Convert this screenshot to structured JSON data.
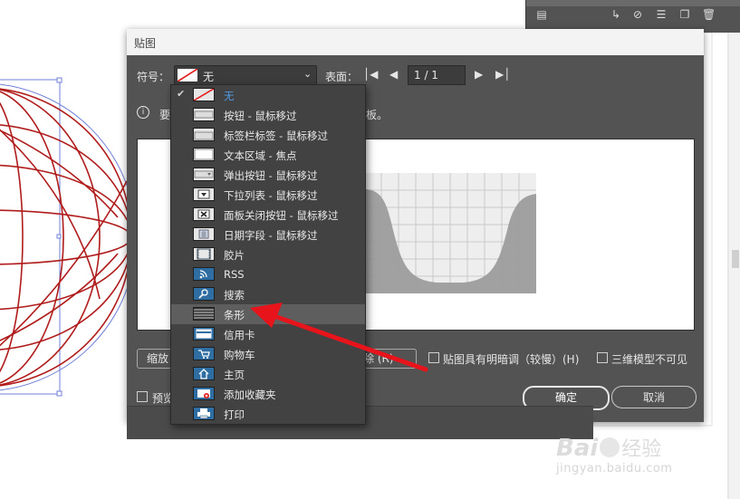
{
  "dialog": {
    "title": "贴图",
    "symbol_label": "符号：",
    "symbol_value": "无",
    "surface_label": "表面：",
    "page_value": "1 / 1",
    "info_prefix": "要",
    "info_suffix": "板。",
    "scale_button": "缩放",
    "clear_button": "清除 (R)",
    "shade_label": "贴图具有明暗调（较慢）(H)",
    "invisible_label": "三维模型不可见",
    "preview_label": "预览",
    "ok_label": "确定",
    "cancel_label": "取消"
  },
  "dropdown": {
    "items": [
      {
        "label": "无",
        "icon": "none-icon",
        "selected": true
      },
      {
        "label": "按钮 - 鼠标移过",
        "icon": "button-icon"
      },
      {
        "label": "标签栏标签 - 鼠标移过",
        "icon": "tab-icon"
      },
      {
        "label": "文本区域 - 焦点",
        "icon": "text-area-icon"
      },
      {
        "label": "弹出按钮 - 鼠标移过",
        "icon": "popup-button-icon"
      },
      {
        "label": "下拉列表 - 鼠标移过",
        "icon": "dropdown-list-icon"
      },
      {
        "label": "面板关闭按钮 - 鼠标移过",
        "icon": "panel-close-icon"
      },
      {
        "label": "日期字段 - 鼠标移过",
        "icon": "date-field-icon"
      },
      {
        "label": "胶片",
        "icon": "film-icon"
      },
      {
        "label": "RSS",
        "icon": "rss-icon"
      },
      {
        "label": "搜索",
        "icon": "search-icon"
      },
      {
        "label": "条形",
        "icon": "stripes-icon",
        "hovered": true
      },
      {
        "label": "信用卡",
        "icon": "credit-card-icon"
      },
      {
        "label": "购物车",
        "icon": "shopping-cart-icon"
      },
      {
        "label": "主页",
        "icon": "home-icon"
      },
      {
        "label": "添加收藏夹",
        "icon": "add-favorite-icon"
      },
      {
        "label": "打印",
        "icon": "print-icon"
      }
    ]
  },
  "watermark": {
    "brand": "Bai",
    "brand2": "经验",
    "url": "jingyan.baidu.com"
  },
  "colors": {
    "dialog_bg": "#535353",
    "dropdown_bg": "#424242",
    "accent_blue": "#4f9ae3",
    "arrow_red": "#e8141b",
    "wire_red": "#b01c1c"
  }
}
